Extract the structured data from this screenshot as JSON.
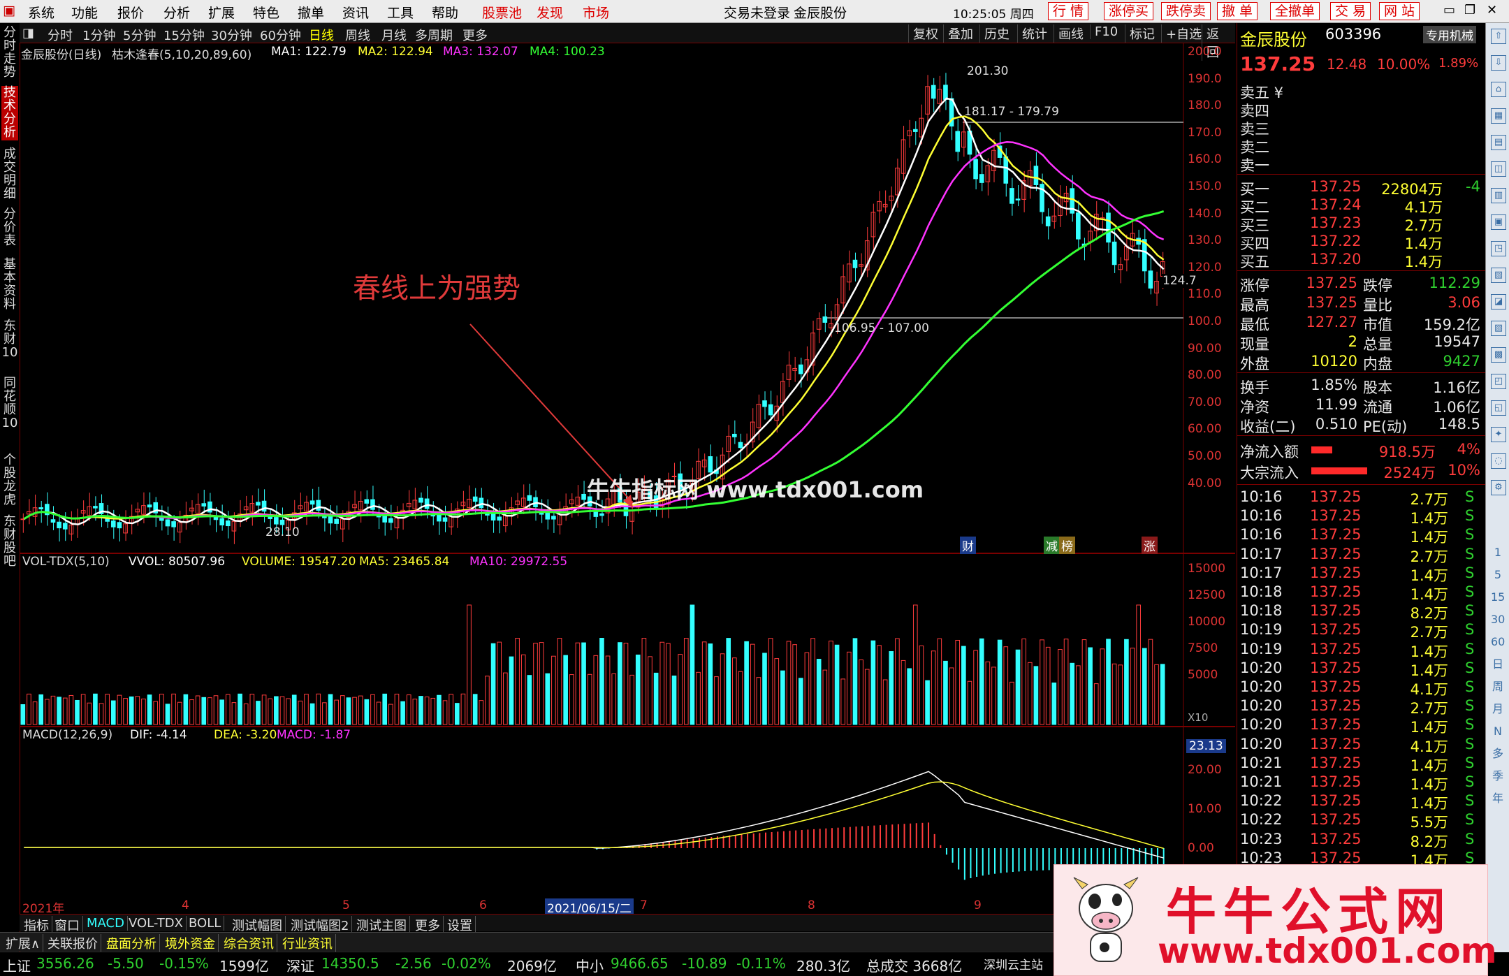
{
  "menu": {
    "items": [
      "系统",
      "功能",
      "报价",
      "分析",
      "扩展",
      "特色",
      "撤单",
      "资讯",
      "工具",
      "帮助"
    ],
    "highlight": [
      "股票池",
      "发现",
      "市场"
    ],
    "login_status": "交易未登录",
    "stock_name_title": "金辰股份",
    "time": "10:25:05 周四",
    "right_buttons": [
      "行 情",
      "涨停买",
      "跌停卖",
      "撤 单",
      "全撤单",
      "交 易",
      "网 站"
    ]
  },
  "left_tabs": [
    "分时走势",
    "技术分析",
    "成交明细",
    "分价表",
    "基本资料",
    "东财10",
    "同花顺10",
    "个股龙虎",
    "东财股吧"
  ],
  "periods": [
    "分时",
    "1分钟",
    "5分钟",
    "15分钟",
    "30分钟",
    "60分钟",
    "日线",
    "周线",
    "月线",
    "多周期",
    "更多"
  ],
  "selected_period": "日线",
  "toolbar_right": [
    "复权",
    "叠加",
    "历史",
    "统计",
    "画线",
    "F10",
    "标记",
    "+自选",
    "返回"
  ],
  "chart": {
    "title": "金辰股份(日线)",
    "indicator_name": "枯木逢春(5,10,20,89,60)",
    "ma1": "MA1: 122.79",
    "ma2": "MA2: 122.94",
    "ma3": "MA3: 132.07",
    "ma4": "MA4: 100.23",
    "price_axis": [
      "200.0",
      "190.0",
      "180.0",
      "170.0",
      "160.0",
      "150.0",
      "140.0",
      "130.0",
      "120.0",
      "110.0",
      "100.0",
      "90.00",
      "80.00",
      "70.00",
      "60.00",
      "50.00",
      "40.00"
    ],
    "high_label": "201.30",
    "range_label_top": "181.17 - 179.79",
    "range_label_bottom": "106.95 - 107.00",
    "low_label": "28.10",
    "right_price_label": "124.7",
    "event_markers": [
      "财",
      "减",
      "榜",
      "涨"
    ],
    "annotation": "春线上为强势",
    "watermark_mid": "牛牛指标网 www.tdx001.com"
  },
  "volume": {
    "label": "VOL-TDX(5,10)",
    "vvol": "VVOL: 80507.96",
    "volume": "VOLUME: 19547.20",
    "ma5": "MA5: 23465.84",
    "ma10": "MA10: 29972.55",
    "axis": [
      "15000",
      "12500",
      "10000",
      "7500",
      "5000"
    ],
    "unit": "X10"
  },
  "macd": {
    "label": "MACD(12,26,9)",
    "dif": "DIF: -4.14",
    "dea": "DEA: -3.20",
    "macd": "MACD: -1.87",
    "axis_top": "23.13",
    "axis": [
      "20.00",
      "10.00",
      "0.00"
    ]
  },
  "date_axis": [
    "2021年",
    "4",
    "5",
    "6",
    "7",
    "8",
    "9"
  ],
  "date_cursor": "2021/06/15/二",
  "bottom_tabs": [
    "指标",
    "窗口",
    "MACD",
    "VOL-TDX",
    "BOLL",
    "测试幅图",
    "测试幅图2",
    "测试主图",
    "更多",
    "设置"
  ],
  "info_tabs": [
    "扩展∧",
    "关联报价",
    "盘面分析",
    "境外资金",
    "综合资讯",
    "行业资讯"
  ],
  "index_bar": [
    {
      "name": "上证",
      "value": "3556.26",
      "chg": "-5.50",
      "pct": "-0.15%",
      "amt": "1599亿"
    },
    {
      "name": "深证",
      "value": "14350.5",
      "chg": "-2.56",
      "pct": "-0.02%",
      "amt": "2069亿"
    },
    {
      "name": "中小",
      "value": "9466.65",
      "chg": "-10.89",
      "pct": "-0.11%",
      "amt": "280.3亿"
    }
  ],
  "total_trade": "总成交 3668亿",
  "server": "深圳云主站",
  "quote": {
    "name": "金辰股份",
    "code": "603396",
    "tag": "专用机械",
    "price": "137.25",
    "change": "12.48",
    "pct": "10.00%",
    "extra": "1.89%",
    "sells": [
      "卖五 ¥",
      "卖四",
      "卖三",
      "卖二",
      "卖一"
    ],
    "buys": [
      {
        "label": "买一",
        "price": "137.25",
        "vol": "22804万",
        "diff": "-4"
      },
      {
        "label": "买二",
        "price": "137.24",
        "vol": "4.1万",
        "diff": ""
      },
      {
        "label": "买三",
        "price": "137.23",
        "vol": "2.7万",
        "diff": ""
      },
      {
        "label": "买四",
        "price": "137.22",
        "vol": "1.4万",
        "diff": ""
      },
      {
        "label": "买五",
        "price": "137.20",
        "vol": "1.4万",
        "diff": ""
      }
    ],
    "stats": [
      {
        "l1": "涨停",
        "v1": "137.25",
        "l2": "跌停",
        "v2": "112.29"
      },
      {
        "l1": "最高",
        "v1": "137.25",
        "l2": "量比",
        "v2": "3.06"
      },
      {
        "l1": "最低",
        "v1": "127.27",
        "l2": "市值",
        "v2": "159.2亿"
      },
      {
        "l1": "现量",
        "v1": "2",
        "l2": "总量",
        "v2": "19547"
      },
      {
        "l1": "外盘",
        "v1": "10120",
        "l2": "内盘",
        "v2": "9427"
      }
    ],
    "stats2": [
      {
        "l1": "换手",
        "v1": "1.85%",
        "l2": "股本",
        "v2": "1.16亿"
      },
      {
        "l1": "净资",
        "v1": "11.99",
        "l2": "流通",
        "v2": "1.06亿"
      },
      {
        "l1": "收益(二)",
        "v1": "0.510",
        "l2": "PE(动)",
        "v2": "148.5"
      }
    ],
    "flows": [
      {
        "label": "净流入额",
        "value": "918.5万",
        "pct": "4%"
      },
      {
        "label": "大宗流入",
        "value": "2524万",
        "pct": "10%"
      }
    ],
    "ticks": [
      {
        "t": "10:16",
        "p": "137.25",
        "v": "2.7万",
        "s": "S"
      },
      {
        "t": "10:16",
        "p": "137.25",
        "v": "1.4万",
        "s": "S"
      },
      {
        "t": "10:16",
        "p": "137.25",
        "v": "1.4万",
        "s": "S"
      },
      {
        "t": "10:17",
        "p": "137.25",
        "v": "2.7万",
        "s": "S"
      },
      {
        "t": "10:17",
        "p": "137.25",
        "v": "1.4万",
        "s": "S"
      },
      {
        "t": "10:18",
        "p": "137.25",
        "v": "1.4万",
        "s": "S"
      },
      {
        "t": "10:18",
        "p": "137.25",
        "v": "8.2万",
        "s": "S"
      },
      {
        "t": "10:19",
        "p": "137.25",
        "v": "2.7万",
        "s": "S"
      },
      {
        "t": "10:19",
        "p": "137.25",
        "v": "1.4万",
        "s": "S"
      },
      {
        "t": "10:20",
        "p": "137.25",
        "v": "1.4万",
        "s": "S"
      },
      {
        "t": "10:20",
        "p": "137.25",
        "v": "4.1万",
        "s": "S"
      },
      {
        "t": "10:20",
        "p": "137.25",
        "v": "2.7万",
        "s": "S"
      },
      {
        "t": "10:20",
        "p": "137.25",
        "v": "1.4万",
        "s": "S"
      },
      {
        "t": "10:20",
        "p": "137.25",
        "v": "4.1万",
        "s": "S"
      },
      {
        "t": "10:21",
        "p": "137.25",
        "v": "1.4万",
        "s": "S"
      },
      {
        "t": "10:21",
        "p": "137.25",
        "v": "1.4万",
        "s": "S"
      },
      {
        "t": "10:22",
        "p": "137.25",
        "v": "1.4万",
        "s": "S"
      },
      {
        "t": "10:22",
        "p": "137.25",
        "v": "5.5万",
        "s": "S"
      },
      {
        "t": "10:23",
        "p": "137.25",
        "v": "8.2万",
        "s": "S"
      },
      {
        "t": "10:23",
        "p": "137.25",
        "v": "1.4万",
        "s": "S"
      }
    ]
  },
  "right_icons": [
    "1",
    "5",
    "15",
    "30",
    "60",
    "日",
    "周",
    "月",
    "N",
    "多",
    "季",
    "年"
  ],
  "watermark": {
    "title": "牛牛公式网",
    "url": "www.tdx001.com"
  },
  "colors": {
    "up": "#ff3c3c",
    "down": "#3ff",
    "ma1": "#ffffff",
    "ma2": "#ffff33",
    "ma3": "#ff33ff",
    "ma4": "#33ff33"
  }
}
